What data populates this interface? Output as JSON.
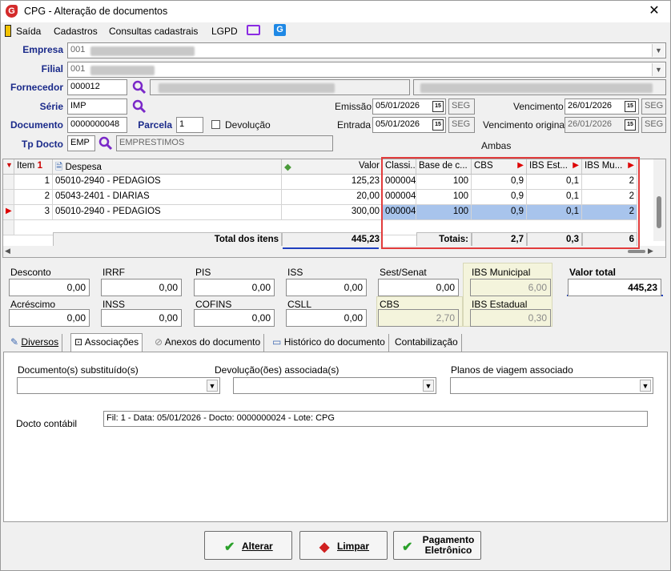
{
  "window": {
    "title": "CPG - Alteração de documentos",
    "close": "✕"
  },
  "menu": [
    "Saída",
    "Cadastros",
    "Consultas cadastrais",
    "LGPD"
  ],
  "header": {
    "empresa_label": "Empresa",
    "empresa_code": "001",
    "filial_label": "Filial",
    "filial_code": "001",
    "fornecedor_label": "Fornecedor",
    "fornecedor_code": "000012",
    "serie_label": "Série",
    "serie_value": "IMP",
    "documento_label": "Documento",
    "documento_value": "0000000048",
    "parcela_label": "Parcela",
    "parcela_value": "1",
    "devolucao_label": "Devolução",
    "tpdocto_label": "Tp Docto",
    "tpdocto_code": "EMP",
    "tpdocto_desc": "EMPRESTIMOS",
    "emissao_label": "Emissão",
    "emissao_value": "05/01/2026",
    "emissao_day": "SEG",
    "entrada_label": "Entrada",
    "entrada_value": "05/01/2026",
    "entrada_day": "SEG",
    "vencimento_label": "Vencimento",
    "vencimento_value": "26/01/2026",
    "vencimento_day": "SEG",
    "vencorig_label": "Vencimento original",
    "vencorig_value": "26/01/2026",
    "vencorig_day": "SEG",
    "ambas": "Ambas"
  },
  "grid": {
    "headers": [
      "Item",
      "Despesa",
      "Valor",
      "Classi...",
      "Base de c...",
      "CBS",
      "IBS Est...",
      "IBS Mu..."
    ],
    "rows": [
      {
        "item": "1",
        "despesa": "05010-2940 - PEDAGIOS",
        "valor": "125,23",
        "classi": "000004",
        "base": "100",
        "cbs": "0,9",
        "ibs_est": "0,1",
        "ibs_mun": "2"
      },
      {
        "item": "2",
        "despesa": "05043-2401 - DIARIAS",
        "valor": "20,00",
        "classi": "000004",
        "base": "100",
        "cbs": "0,9",
        "ibs_est": "0,1",
        "ibs_mun": "2"
      },
      {
        "item": "3",
        "despesa": "05010-2940 - PEDAGIOS",
        "valor": "300,00",
        "classi": "000004",
        "base": "100",
        "cbs": "0,9",
        "ibs_est": "0,1",
        "ibs_mun": "2"
      }
    ],
    "total_label": "Total dos itens",
    "total_value": "445,23",
    "totais_label": "Totais:",
    "tot_cbs": "2,7",
    "tot_ibs_est": "0,3",
    "tot_ibs_mun": "6"
  },
  "values": {
    "desconto_label": "Desconto",
    "desconto": "0,00",
    "irrf_label": "IRRF",
    "irrf": "0,00",
    "pis_label": "PIS",
    "pis": "0,00",
    "iss_label": "ISS",
    "iss": "0,00",
    "sest_label": "Sest/Senat",
    "sest": "0,00",
    "ibsmun_label": "IBS Municipal",
    "ibsmun": "6,00",
    "valortotal_label": "Valor total",
    "valortotal": "445,23",
    "acrescimo_label": "Acréscimo",
    "acrescimo": "0,00",
    "inss_label": "INSS",
    "inss": "0,00",
    "cofins_label": "COFINS",
    "cofins": "0,00",
    "csll_label": "CSLL",
    "csll": "0,00",
    "cbs_label": "CBS",
    "cbs": "2,70",
    "ibsest_label": "IBS Estadual",
    "ibsest": "0,30"
  },
  "tabs": [
    "Diversos",
    "Associações",
    "Anexos do documento",
    "Histórico do documento",
    "Contabilização"
  ],
  "assoc": {
    "substituidos_label": "Documento(s) substituído(s)",
    "devolucoes_label": "Devolução(ões) associada(s)",
    "planos_label": "Planos de viagem associado",
    "contabil_label": "Docto contábil",
    "contabil_value": "Fil: 1 - Data: 05/01/2026 - Docto: 0000000024 - Lote: CPG"
  },
  "buttons": {
    "alterar": "Alterar",
    "limpar": "Limpar",
    "pagamento1": "Pagamento",
    "pagamento2": "Eletrônico"
  },
  "colors": {
    "label_blue": "#1a2a8a",
    "highlight_red": "#e23c3c",
    "underline_blue": "#1f3fbf",
    "selected_row": "#a8c4ec"
  }
}
